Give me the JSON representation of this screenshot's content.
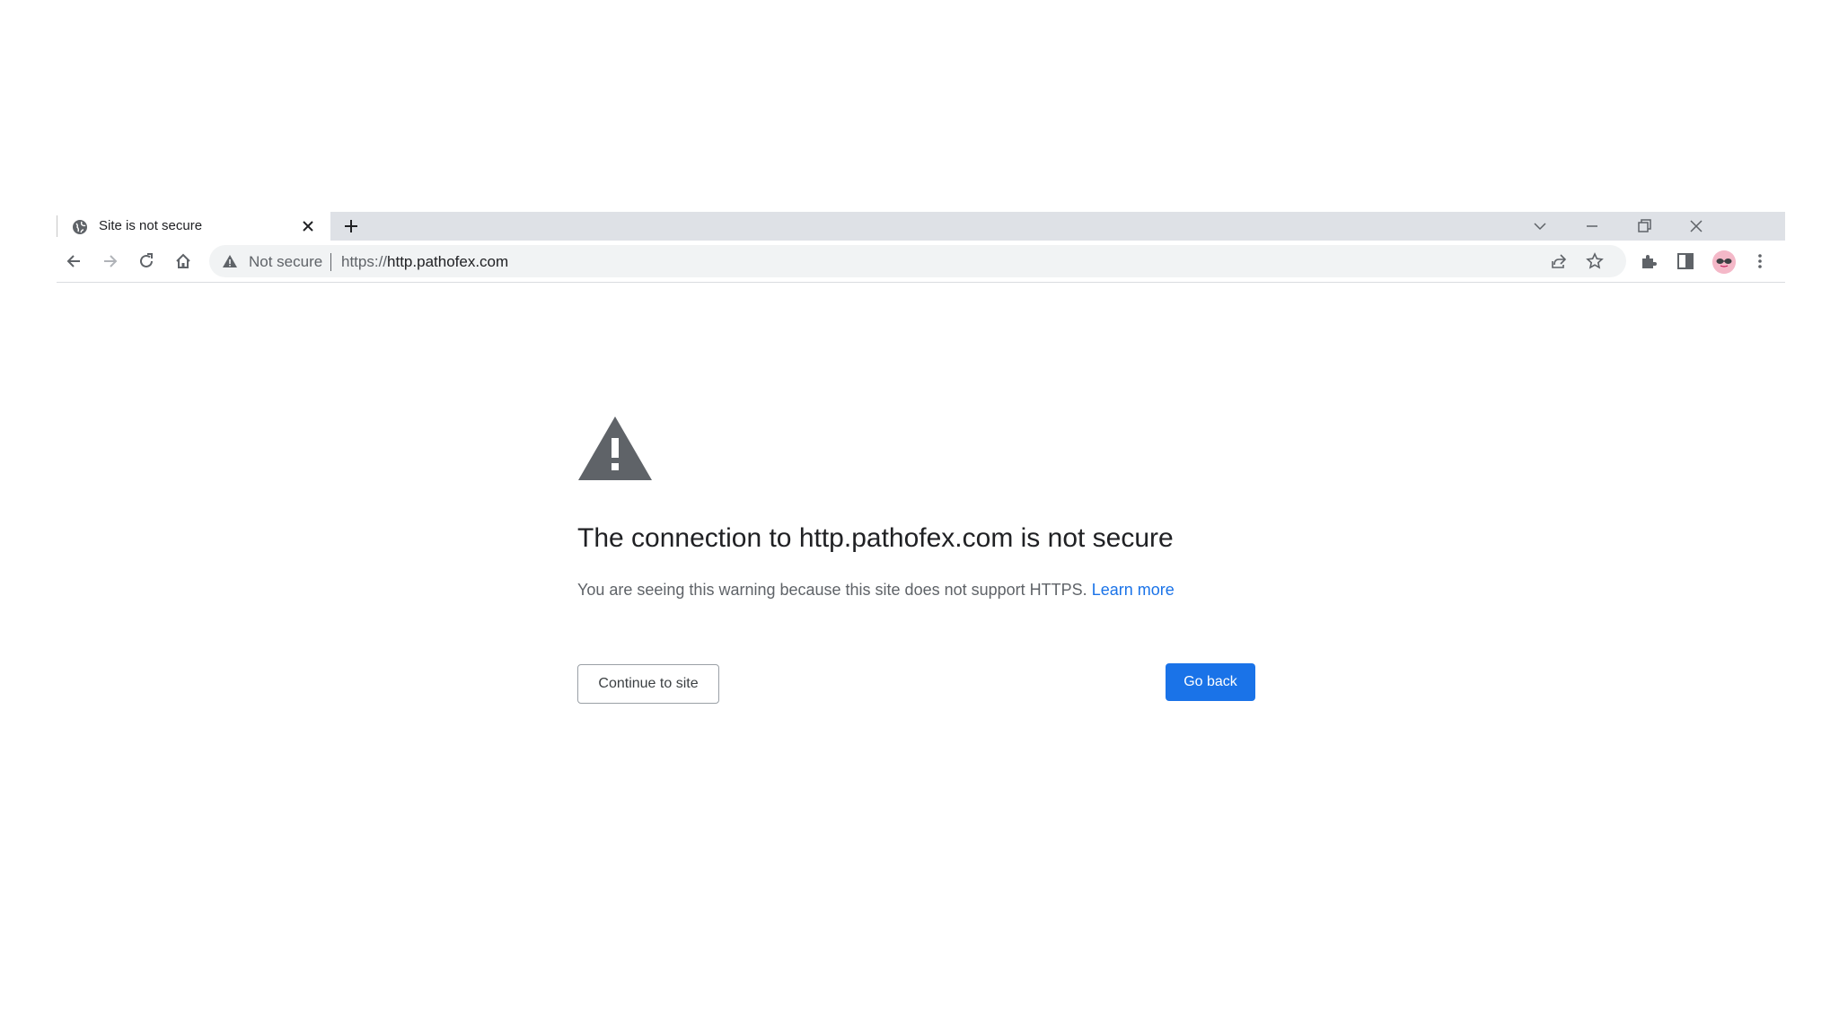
{
  "tab": {
    "title": "Site is not secure",
    "favicon": "globe-icon",
    "close_icon": "close-icon"
  },
  "tabstrip": {
    "new_tab_icon": "plus-icon",
    "tab_search_icon": "chevron-down-icon",
    "minimize_icon": "minimize-icon",
    "restore_icon": "restore-icon",
    "close_window_icon": "close-icon"
  },
  "toolbar": {
    "back_icon": "arrow-left-icon",
    "forward_icon": "arrow-right-icon",
    "reload_icon": "reload-icon",
    "home_icon": "home-icon",
    "share_icon": "share-icon",
    "bookmark_icon": "star-icon",
    "extensions_icon": "puzzle-icon",
    "side_panel_icon": "side-panel-icon",
    "avatar": "profile-avatar",
    "menu_icon": "kebab-menu-icon"
  },
  "omnibox": {
    "security_label": "Not secure",
    "url_scheme": "https://",
    "url_host": "http.pathofex.com",
    "warning_icon": "warning-triangle-icon"
  },
  "interstitial": {
    "heading": "The connection to http.pathofex.com is not secure",
    "description": "You are seeing this warning because this site does not support HTTPS.",
    "learn_more": "Learn more",
    "continue_label": "Continue to site",
    "go_back_label": "Go back",
    "warning_icon": "warning-triangle-icon"
  },
  "colors": {
    "accent": "#1a73e8",
    "tabstrip_bg": "#dee1e6",
    "omnibox_bg": "#f1f3f4",
    "icon_gray": "#5f6368",
    "heading_text": "#202124"
  }
}
